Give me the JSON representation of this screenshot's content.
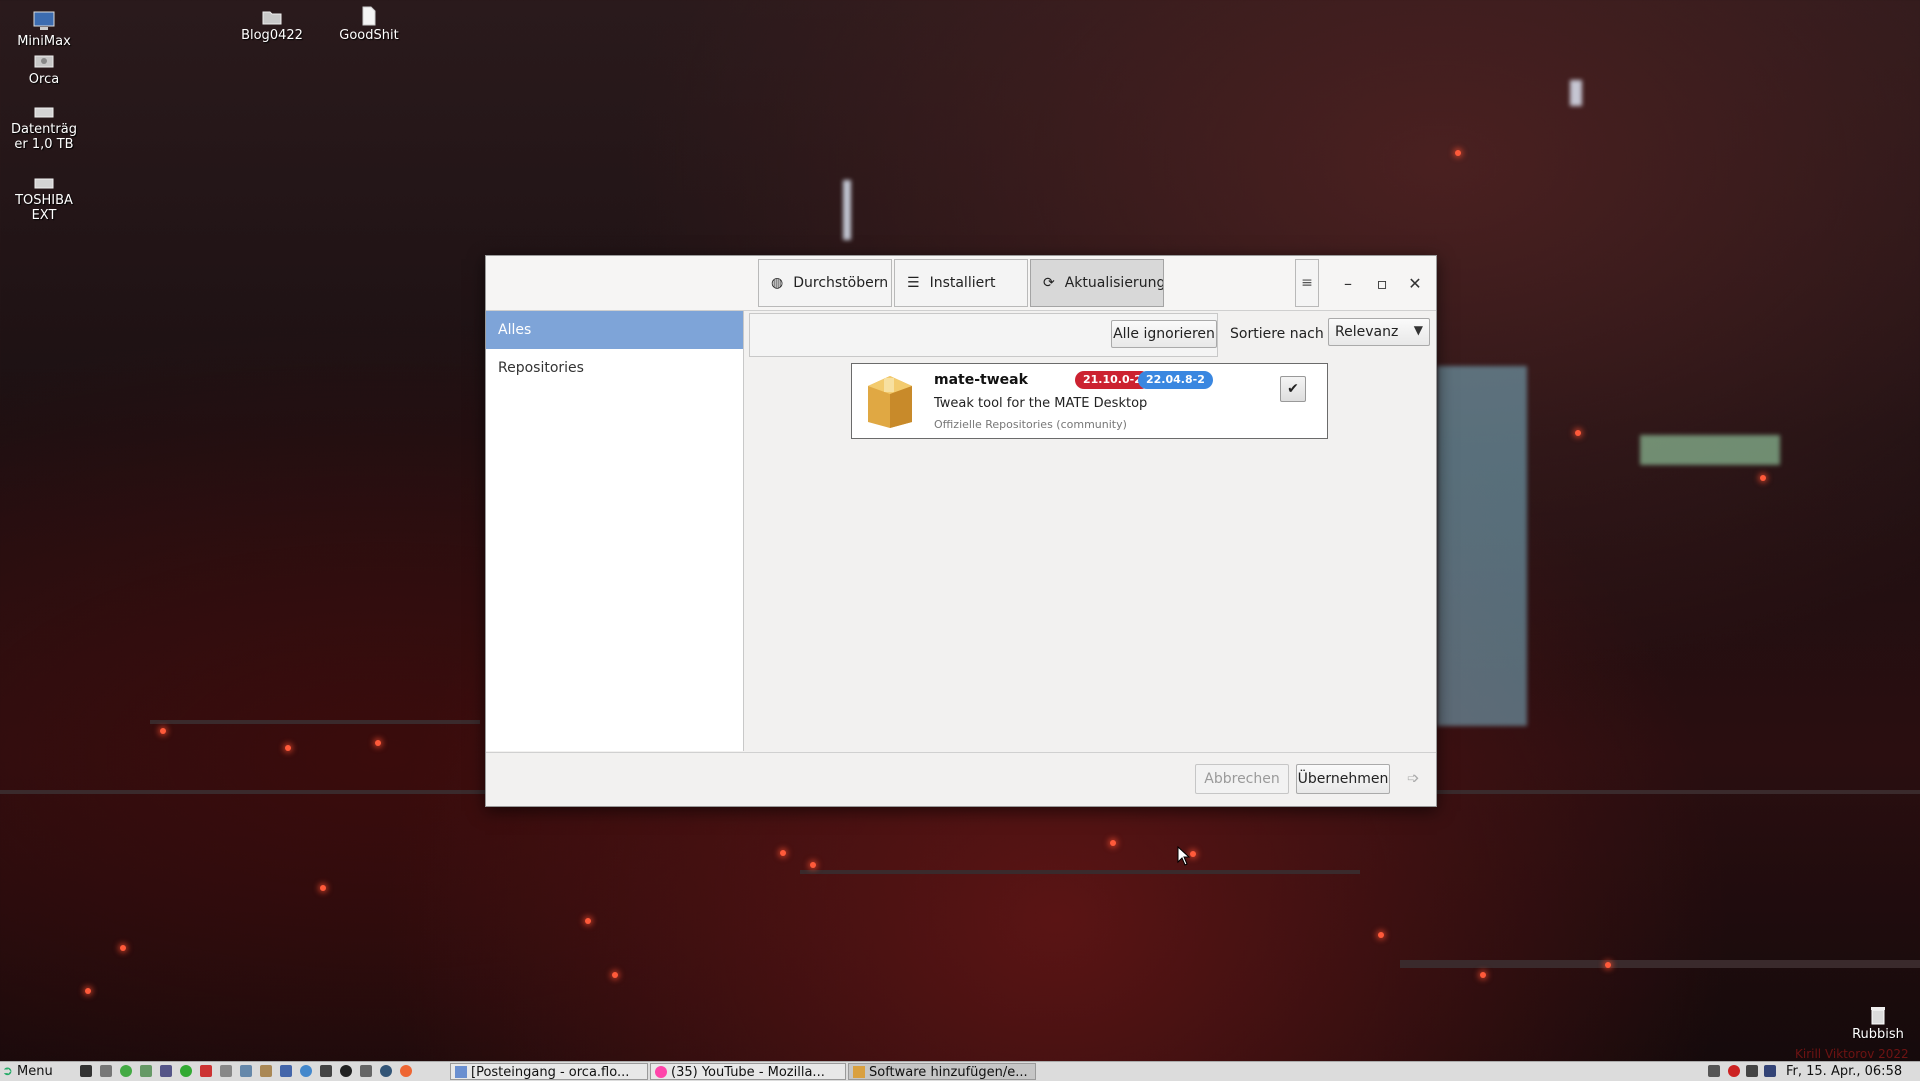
{
  "desktop": {
    "icons": [
      {
        "label": "MiniMax"
      },
      {
        "label": "Orca"
      },
      {
        "label": "Datenträg er 1,0 TB"
      },
      {
        "label": "TOSHIBA EXT"
      },
      {
        "label": "Blog0422"
      },
      {
        "label": "GoodShit"
      },
      {
        "label": "Rubbish"
      }
    ],
    "watermark": "Kirill Viktorov 2022"
  },
  "window": {
    "tabs": [
      {
        "label": "Durchstöbern",
        "icon": "globe-icon"
      },
      {
        "label": "Installiert",
        "icon": "list-icon"
      },
      {
        "label": "Aktualisierunge",
        "icon": "refresh-icon",
        "active": true
      }
    ],
    "controls": {
      "minimize": "–",
      "maximize": "▫",
      "close": "✕"
    },
    "sidebar": {
      "items": [
        {
          "label": "Alles",
          "selected": true
        },
        {
          "label": "Repositories"
        }
      ]
    },
    "filter": {
      "ignore_all": "Alle ignorieren",
      "sort_label": "Sortiere nach",
      "sort_value": "Relevanz"
    },
    "package": {
      "name": "mate-tweak",
      "description": "Tweak tool for the MATE Desktop",
      "repository": "Offizielle Repositories (community)",
      "old_version": "21.10.0-2",
      "new_version": "22.04.8-2",
      "checked": true
    },
    "actions": {
      "cancel": "Abbrechen",
      "apply": "Übernehmen"
    }
  },
  "taskbar": {
    "menu_label": "Menu",
    "tasks": [
      {
        "label": "[Posteingang - orca.flo..."
      },
      {
        "label": "(35) YouTube - Mozilla..."
      },
      {
        "label": "Software hinzufügen/e...",
        "active": true
      }
    ],
    "clock": "Fr, 15. Apr., 06:58"
  },
  "colors": {
    "accent": "#7ea4d8",
    "badge_old": "#cc2230",
    "badge_new": "#3a87e0"
  }
}
